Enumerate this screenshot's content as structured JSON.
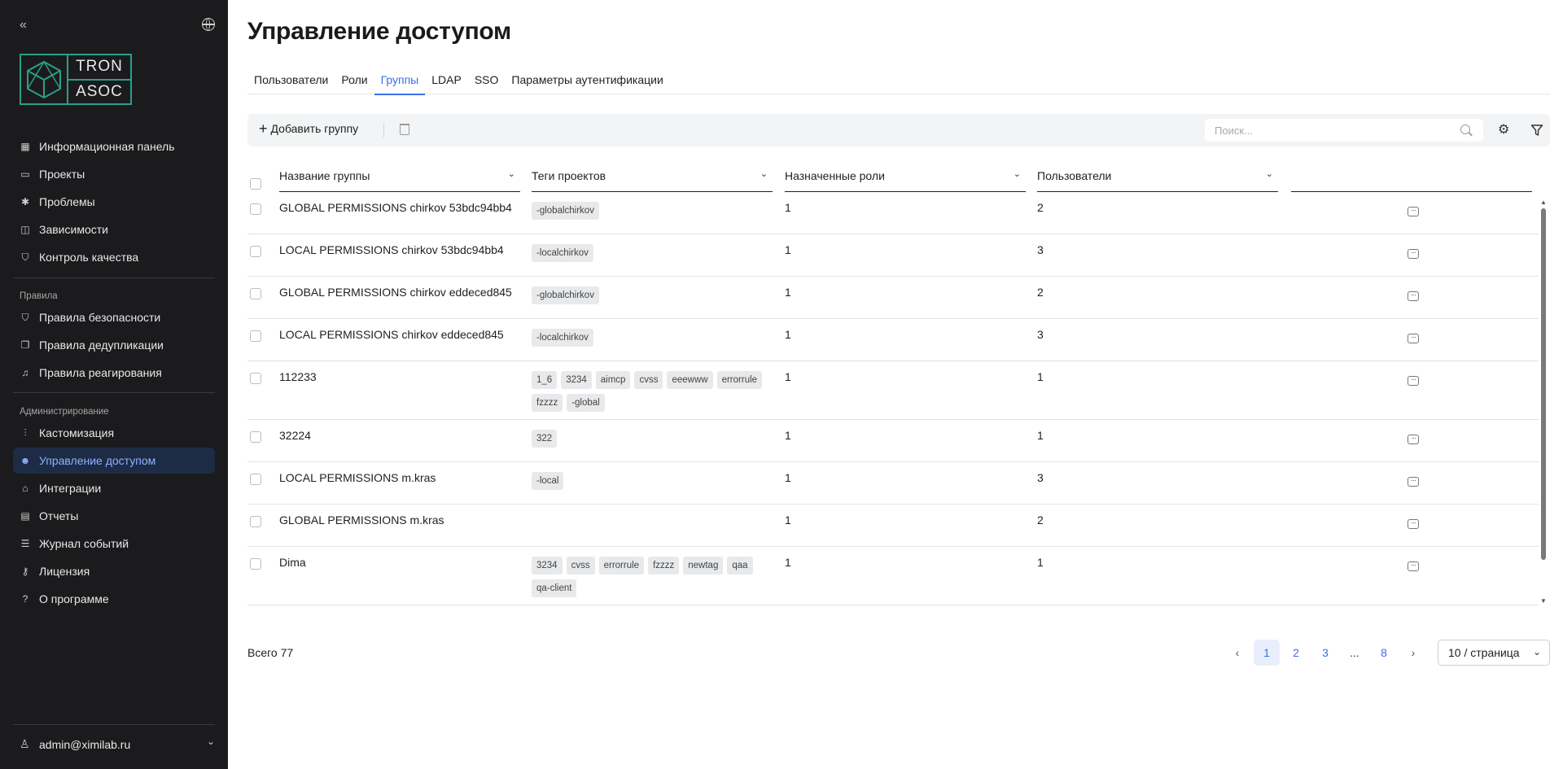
{
  "sidebar": {
    "logo_top": "TRON",
    "logo_bottom": "ASOC",
    "nav_main": [
      {
        "label": "Информационная панель",
        "icon": "dashboard-icon"
      },
      {
        "label": "Проекты",
        "icon": "folder-icon"
      },
      {
        "label": "Проблемы",
        "icon": "bug-icon"
      },
      {
        "label": "Зависимости",
        "icon": "book-icon"
      },
      {
        "label": "Контроль качества",
        "icon": "shield-check-icon"
      }
    ],
    "section_rules": "Правила",
    "nav_rules": [
      {
        "label": "Правила безопасности",
        "icon": "shield-icon"
      },
      {
        "label": "Правила дедупликации",
        "icon": "copy-icon"
      },
      {
        "label": "Правила реагирования",
        "icon": "bell-icon"
      }
    ],
    "section_admin": "Администрирование",
    "nav_admin": [
      {
        "label": "Кастомизация",
        "icon": "sliders-icon"
      },
      {
        "label": "Управление доступом",
        "icon": "users-icon",
        "active": true
      },
      {
        "label": "Интеграции",
        "icon": "integration-icon"
      },
      {
        "label": "Отчеты",
        "icon": "report-icon"
      },
      {
        "label": "Журнал событий",
        "icon": "log-icon"
      },
      {
        "label": "Лицензия",
        "icon": "key-icon"
      },
      {
        "label": "О программе",
        "icon": "help-icon"
      }
    ],
    "user": "admin@ximilab.ru"
  },
  "page": {
    "title": "Управление доступом",
    "tabs": [
      "Пользователи",
      "Роли",
      "Группы",
      "LDAP",
      "SSO",
      "Параметры аутентификации"
    ],
    "active_tab": "Группы"
  },
  "toolbar": {
    "add_label": "Добавить группу",
    "search_placeholder": "Поиск..."
  },
  "table": {
    "columns": [
      "Название группы",
      "Теги проектов",
      "Назначенные роли",
      "Пользователи"
    ],
    "rows": [
      {
        "name": "GLOBAL PERMISSIONS chirkov 53bdc94bb4",
        "tags": [
          "-globalchirkov"
        ],
        "roles": "1",
        "users": "2"
      },
      {
        "name": "LOCAL PERMISSIONS chirkov 53bdc94bb4",
        "tags": [
          "-localchirkov"
        ],
        "roles": "1",
        "users": "3"
      },
      {
        "name": "GLOBAL PERMISSIONS chirkov eddeced845",
        "tags": [
          "-globalchirkov"
        ],
        "roles": "1",
        "users": "2"
      },
      {
        "name": "LOCAL PERMISSIONS chirkov eddeced845",
        "tags": [
          "-localchirkov"
        ],
        "roles": "1",
        "users": "3"
      },
      {
        "name": "112233",
        "tags": [
          "1_6",
          "3234",
          "aimcp",
          "cvss",
          "eeewww",
          "errorrule",
          "fzzzz",
          "-global"
        ],
        "roles": "1",
        "users": "1"
      },
      {
        "name": "32224",
        "tags": [
          "322"
        ],
        "roles": "1",
        "users": "1"
      },
      {
        "name": "LOCAL PERMISSIONS m.kras",
        "tags": [
          "-local"
        ],
        "roles": "1",
        "users": "3"
      },
      {
        "name": "GLOBAL PERMISSIONS m.kras",
        "tags": [],
        "roles": "1",
        "users": "2"
      },
      {
        "name": "Dima",
        "tags": [
          "3234",
          "cvss",
          "errorrule",
          "fzzzz",
          "newtag",
          "qaa",
          "qa-client"
        ],
        "roles": "1",
        "users": "1"
      }
    ]
  },
  "footer": {
    "total": "Всего 77",
    "pages": [
      "1",
      "2",
      "3",
      "...",
      "8"
    ],
    "current_page": "1",
    "per_page": "10 / страница"
  }
}
